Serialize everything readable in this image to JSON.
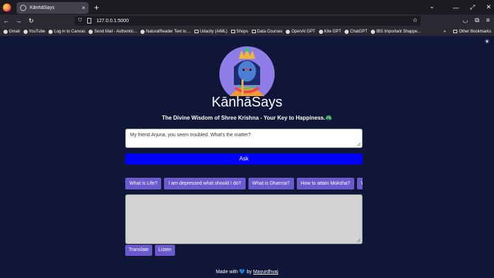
{
  "browser": {
    "tab_title": "KānhāSays",
    "tab_close": "×",
    "new_tab": "+",
    "url": "127.0.0.1:5000",
    "bookmarks": [
      "Gmail",
      "YouTube",
      "Log in to Canvas",
      "Send Mail - Authentic...",
      "NaturalReader Text to ...",
      "Udacity (AIML)",
      "Shops",
      "Data Courses",
      "OpenAI GPT",
      "Kite GPT",
      "ChatGPT",
      "IBS Important Shappe..."
    ],
    "other_bookmarks": "Other Bookmarks"
  },
  "app": {
    "title": "KānhāSays",
    "tagline": "The Divine Wisdom of Shree Krishna - Your Key to Happiness.🦚",
    "question_value": "My friend Arjuna, you seem troubled. What's the matter?",
    "ask_label": "Ask",
    "suggestions": [
      "What is Life?",
      "I am depressed what should I do?",
      "What is Dharma?",
      "How to attain Moksha?",
      "What is Karma?"
    ],
    "answer_value": "",
    "translate_label": "Translate",
    "listen_label": "Listen",
    "footer": {
      "made_with": "Made with",
      "heart": "💙",
      "by": "by",
      "author": "Mayurdhvaj"
    }
  },
  "icons": [
    "firefox-logo-icon",
    "globe-icon",
    "back-icon",
    "forward-icon",
    "reload-icon",
    "shield-icon",
    "star-icon",
    "pocket-icon",
    "extensions-icon",
    "menu-icon",
    "theme-toggle-icon"
  ],
  "colors": {
    "page_bg": "#0f1638",
    "ask_button": "#0000ff",
    "chip": "#6a5acd",
    "answer_bg": "#d3d3d3"
  }
}
